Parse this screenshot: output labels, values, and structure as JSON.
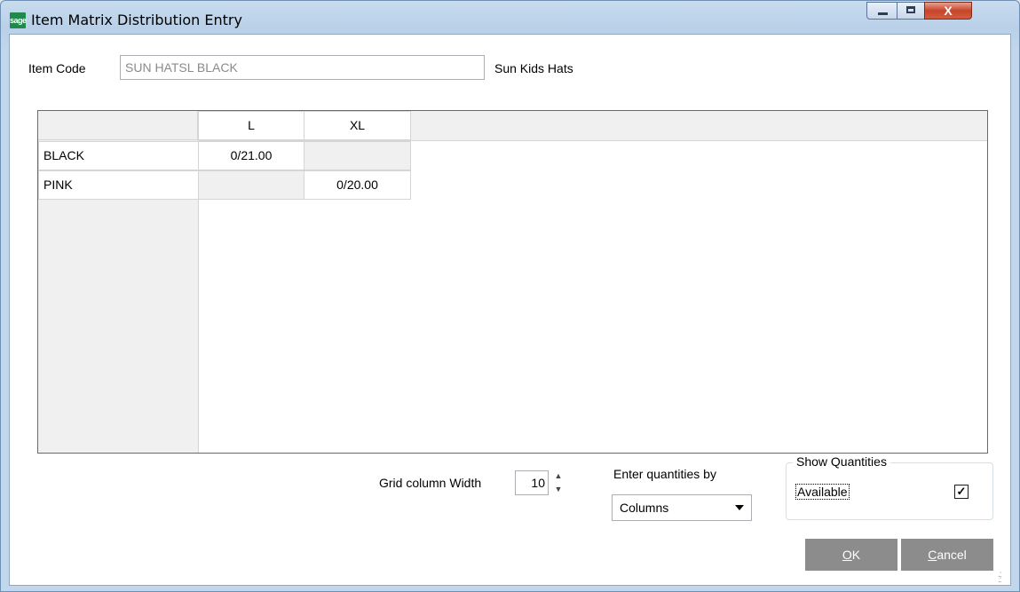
{
  "window": {
    "title": "Item Matrix Distribution Entry",
    "app_icon_text": "sage",
    "controls": {
      "minimize": "minimize-icon",
      "maximize": "maximize-icon",
      "close": "close-icon",
      "close_glyph": "X"
    }
  },
  "item": {
    "code_label": "Item Code",
    "code_value": "SUN HATSL BLACK",
    "description": "Sun Kids Hats"
  },
  "grid": {
    "columns": [
      "L",
      "XL"
    ],
    "rows": [
      {
        "label": "BLACK",
        "cells": [
          "0/21.00",
          ""
        ]
      },
      {
        "label": "PINK",
        "cells": [
          "",
          "0/20.00"
        ]
      }
    ]
  },
  "controls": {
    "col_width_label": "Grid column Width",
    "col_width_value": "10",
    "enter_by_label": "Enter quantities by",
    "enter_by_value": "Columns",
    "show_qty_title": "Show Quantities",
    "show_qty_option": "Available",
    "show_qty_checked": true
  },
  "buttons": {
    "ok_prefix": "",
    "ok_accel": "O",
    "ok_rest": "K",
    "cancel_accel": "C",
    "cancel_rest": "ancel"
  },
  "colors": {
    "button_bg": "#8c8c8c",
    "titlebar": "#b9d0e8",
    "close_btn": "#c7452a"
  }
}
